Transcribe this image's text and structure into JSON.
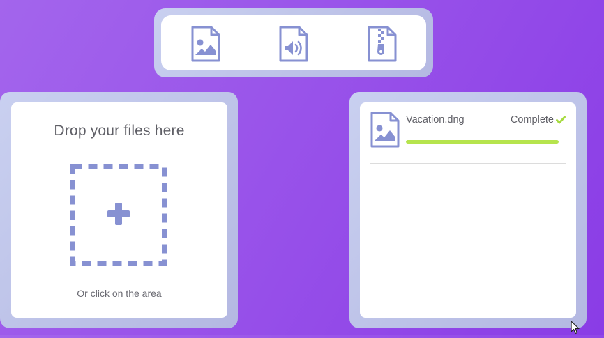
{
  "toolbar": {
    "icons": [
      {
        "name": "image-file-icon"
      },
      {
        "name": "audio-file-icon"
      },
      {
        "name": "zip-file-icon"
      }
    ]
  },
  "dropzone": {
    "title": "Drop your files here",
    "hint": "Or click on the area",
    "icon": "plus-icon"
  },
  "uploads": {
    "items": [
      {
        "file_name": "Vacation.dng",
        "status": "Complete",
        "status_icon": "check-icon",
        "progress": 1.0,
        "icon": "image-file-icon"
      }
    ]
  },
  "colors": {
    "accent": "#8791d2",
    "progress": "#b6e44d",
    "check": "#a6db3f",
    "background_start": "#a365ec",
    "background_end": "#8a3ce6"
  }
}
